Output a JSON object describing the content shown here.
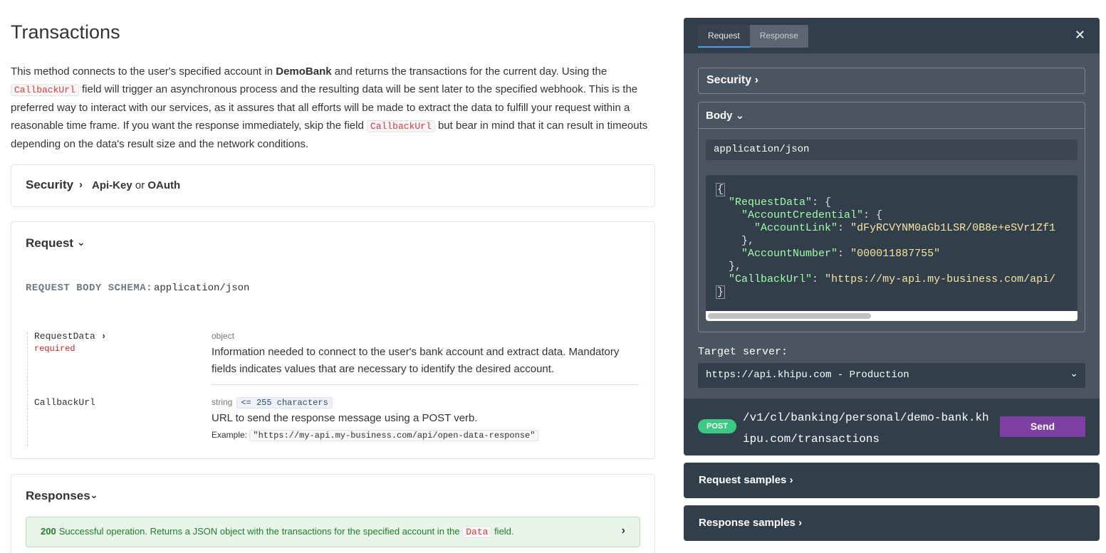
{
  "page": {
    "title": "Transactions",
    "intro": {
      "p1": "This method connects to the user's specified account in ",
      "bank": "DemoBank",
      "p2": " and returns the transactions for the current day. Using the ",
      "code1": "CallbackUrl",
      "p3": " field will trigger an asynchronous process and the resulting data will be sent later to the specified webhook. This is the preferred way to interact with our services, as it assures that all efforts will be made to extract the data to fulfill your request within a reasonable time frame. If you want the response immediately, skip the field ",
      "code2": "CallbackUrl",
      "p4": " but bear in mind that it can result in timeouts depending on the data's result size and the network conditions."
    }
  },
  "security": {
    "title": "Security",
    "scheme1": "Api-Key",
    "or": "or",
    "scheme2": "OAuth"
  },
  "request": {
    "title": "Request",
    "schema_label": "REQUEST BODY SCHEMA:",
    "schema_type": "application/json",
    "props": [
      {
        "name": "RequestData",
        "required": "required",
        "type": "object",
        "description": "Information needed to connect to the user's bank account and extract data. Mandatory fields indicates values that are necessary to identify the desired account."
      },
      {
        "name": "CallbackUrl",
        "type": "string",
        "constraint": "<= 255 characters",
        "description": "URL to send the response message using a POST verb.",
        "example_label": "Example:",
        "example": "\"https://my-api.my-business.com/api/open-data-response\""
      }
    ]
  },
  "responses": {
    "title": "Responses",
    "items": [
      {
        "code": "200",
        "text_before": "Successful operation. Returns a JSON object with the transactions for the specified account in the ",
        "code_field": "Data",
        "text_after": " field."
      }
    ]
  },
  "console": {
    "tabs": [
      "Request",
      "Response"
    ],
    "active_tab": "Request",
    "security_label": "Security",
    "body_label": "Body",
    "content_type": "application/json",
    "json": {
      "open": "{",
      "request_data_key": "\"RequestData\"",
      "account_credential_key": "\"AccountCredential\"",
      "account_link_key": "\"AccountLink\"",
      "account_link_val": "\"dFyRCVYNM0aGb1LSR/0B8e+eSVr1Zf1",
      "account_number_key": "\"AccountNumber\"",
      "account_number_val": "\"000011887755\"",
      "callback_key": "\"CallbackUrl\"",
      "callback_val": "\"https://my-api.my-business.com/api/",
      "close": "}"
    },
    "target_label": "Target server:",
    "target_value": "https://api.khipu.com - Production",
    "method": "POST",
    "path": "/v1/cl/banking/personal/demo-bank.khipu.com/transactions",
    "send_label": "Send"
  },
  "samples": {
    "request_label": "Request samples",
    "response_label": "Response samples"
  }
}
